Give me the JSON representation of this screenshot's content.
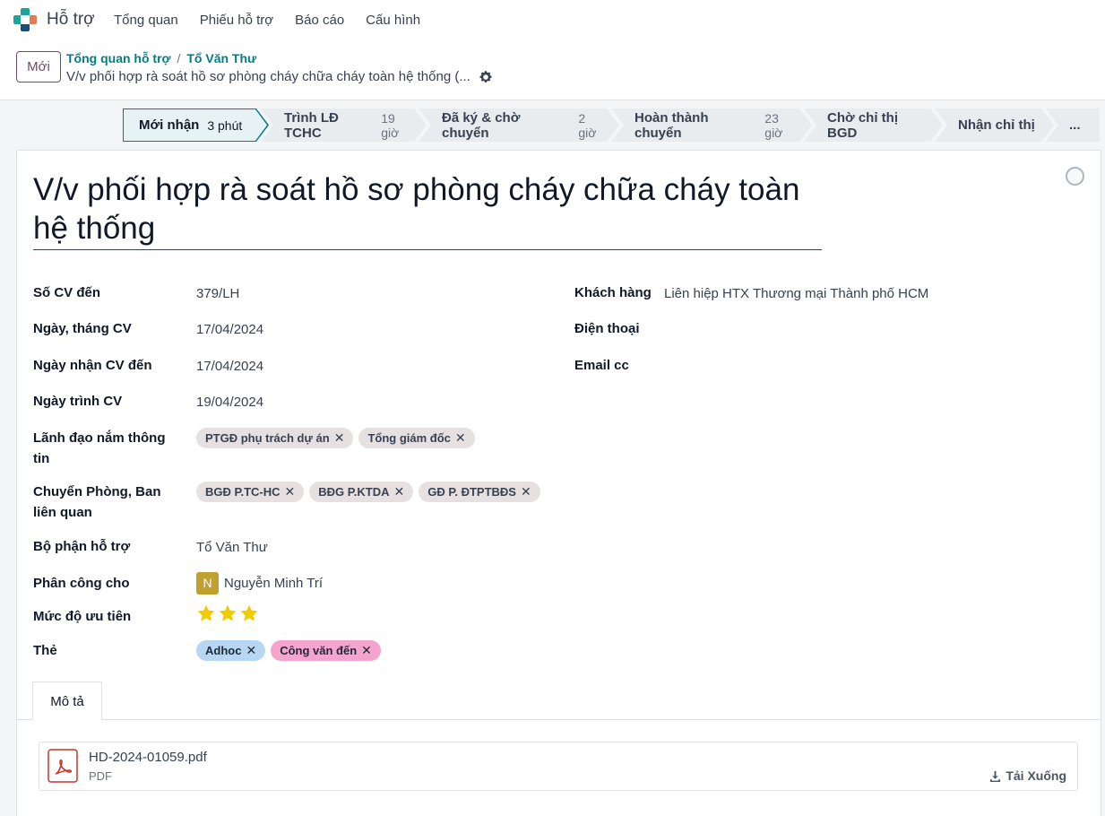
{
  "app": {
    "name": "Hỗ trợ",
    "accent": "#017e84",
    "brand": "#714b67"
  },
  "menu": [
    "Tổng quan",
    "Phiếu hỗ trợ",
    "Báo cáo",
    "Cấu hình"
  ],
  "control": {
    "new_label": "Mới",
    "breadcrumb": [
      "Tổng quan hỗ trợ",
      "Tổ Văn Thư"
    ],
    "breadcrumb_sep": "/",
    "record_title": "V/v phối hợp rà soát hồ sơ phòng cháy chữa cháy toàn hệ thống (..."
  },
  "stages": [
    {
      "label": "Mới nhận",
      "duration": "3 phút",
      "active": true
    },
    {
      "label": "Trình LĐ TCHC",
      "duration": "19 giờ"
    },
    {
      "label": "Đã ký & chờ chuyển",
      "duration": "2 giờ"
    },
    {
      "label": "Hoàn thành chuyển",
      "duration": "23 giờ"
    },
    {
      "label": "Chờ chỉ thị BGD",
      "duration": ""
    },
    {
      "label": "Nhận chỉ thị",
      "duration": ""
    },
    {
      "label": "...",
      "duration": ""
    }
  ],
  "form": {
    "title": "V/v phối hợp rà soát hồ sơ phòng cháy chữa cháy toàn hệ thống",
    "left": {
      "so_cv_label": "Số CV đến",
      "so_cv": "379/LH",
      "ngay_cv_label": "Ngày, tháng CV",
      "ngay_cv": "17/04/2024",
      "ngay_nhan_label": "Ngày nhận CV đến",
      "ngay_nhan": "17/04/2024",
      "ngay_trinh_label": "Ngày trình CV",
      "ngay_trinh": "19/04/2024",
      "lanh_dao_label": "Lãnh đạo nắm thông tin",
      "lanh_dao_tags": [
        "PTGĐ phụ trách dự án",
        "Tổng giám đốc"
      ],
      "chuyen_label": "Chuyển Phòng, Ban liên quan",
      "chuyen_tags": [
        "BGĐ P.TC-HC",
        "BĐG P.KTDA",
        "GĐ P. ĐTPTBĐS"
      ],
      "bo_phan_label": "Bộ phận hỗ trợ",
      "bo_phan": "Tổ Văn Thư",
      "phan_cong_label": "Phân công cho",
      "phan_cong_avatar": "N",
      "phan_cong": "Nguyễn Minh Trí",
      "uu_tien_label": "Mức độ ưu tiên",
      "uu_tien_stars": 3,
      "uu_tien_max": 3,
      "the_label": "Thẻ",
      "the_tags": [
        "Adhoc",
        "Công văn đến"
      ]
    },
    "right": {
      "khach_hang_label": "Khách hàng",
      "khach_hang": "Liên hiệp HTX Thương mại Thành phố HCM",
      "dien_thoai_label": "Điện thoại",
      "email_label": "Email cc"
    }
  },
  "tab": {
    "label": "Mô tả"
  },
  "attachment": {
    "name": "HD-2024-01059.pdf",
    "type": "PDF",
    "download_label": "Tải Xuống"
  }
}
